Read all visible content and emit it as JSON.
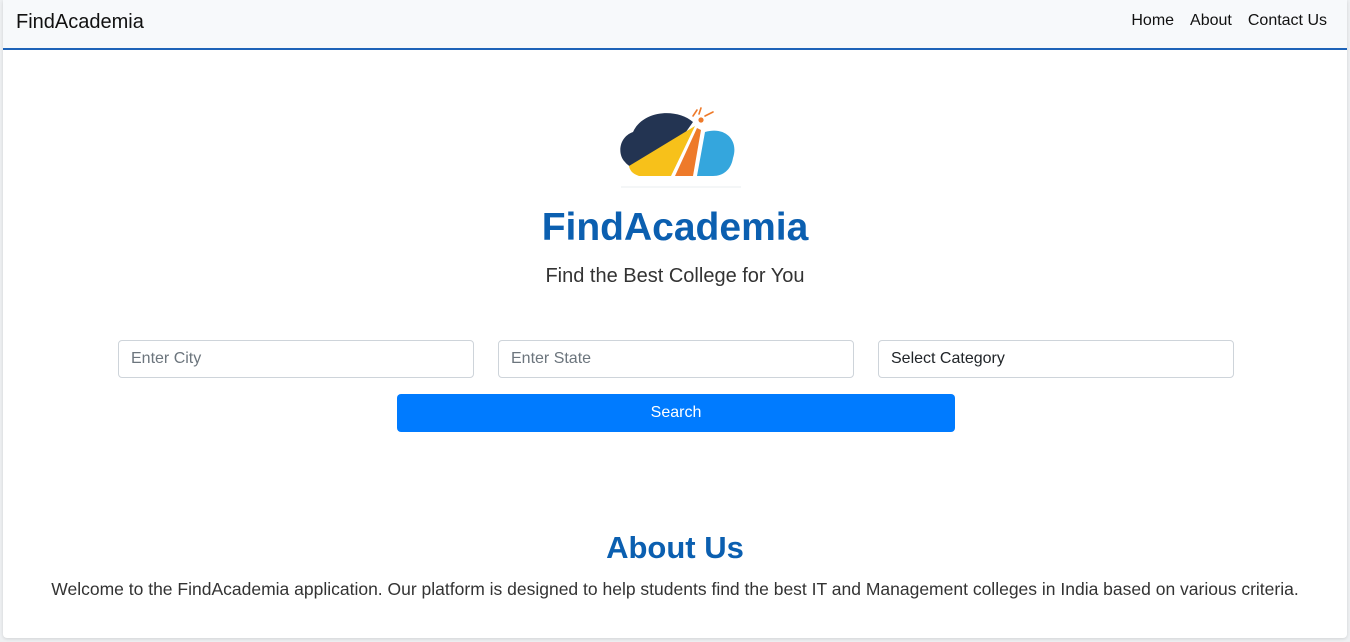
{
  "navbar": {
    "brand": "FindAcademia",
    "links": [
      {
        "label": "Home"
      },
      {
        "label": "About"
      },
      {
        "label": "Contact Us"
      }
    ]
  },
  "hero": {
    "logo_icon": "cloud-logo-icon",
    "title": "FindAcademia",
    "subtitle": "Find the Best College for You"
  },
  "search": {
    "city_placeholder": "Enter City",
    "state_placeholder": "Enter State",
    "category_selected": "Select Category",
    "button_label": "Search"
  },
  "about": {
    "title": "About Us",
    "text": "Welcome to the FindAcademia application. Our platform is designed to help students find the best IT and Management colleges in India based on various criteria."
  },
  "colors": {
    "accent": "#0b5fb0",
    "button": "#007bff",
    "nav_border": "#1e63b8",
    "logo_navy": "#233452",
    "logo_yellow": "#f7c11a",
    "logo_orange": "#ee7a2a",
    "logo_blue": "#34a6dd"
  }
}
